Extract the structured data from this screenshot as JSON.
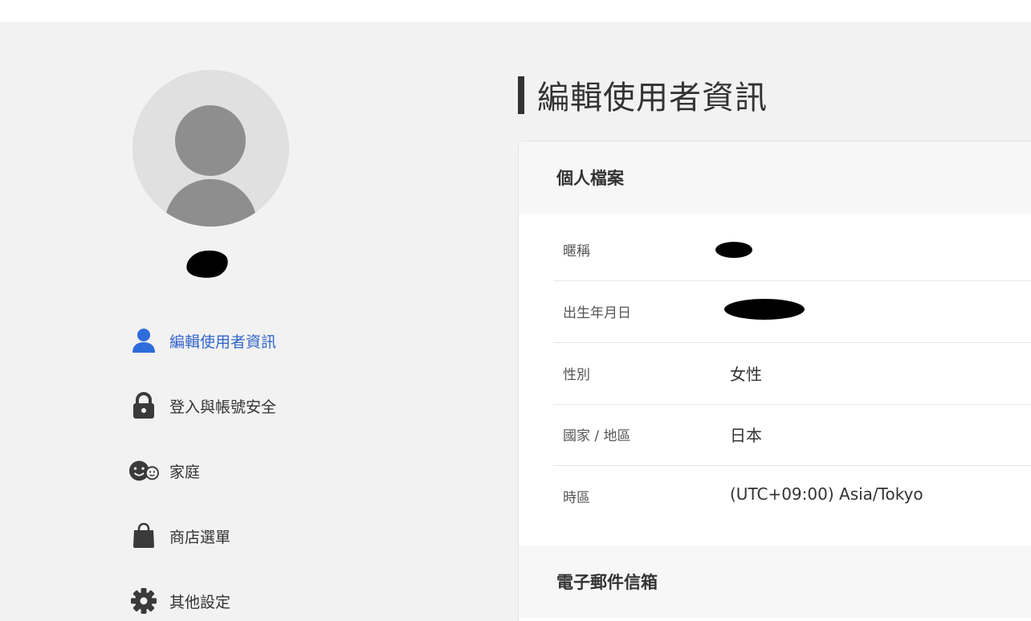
{
  "sidebar": {
    "items": [
      {
        "label": "編輯使用者資訊",
        "icon": "user-icon",
        "active": true
      },
      {
        "label": "登入與帳號安全",
        "icon": "lock-icon",
        "active": false
      },
      {
        "label": "家庭",
        "icon": "family-icon",
        "active": false
      },
      {
        "label": "商店選單",
        "icon": "shopping-bag-icon",
        "active": false
      },
      {
        "label": "其他設定",
        "icon": "gear-icon",
        "active": false
      }
    ]
  },
  "main": {
    "title": "編輯使用者資訊",
    "profile": {
      "heading": "個人檔案",
      "fields": [
        {
          "label": "暱稱",
          "value": ""
        },
        {
          "label": "出生年月日",
          "value": ""
        },
        {
          "label": "性別",
          "value": "女性"
        },
        {
          "label": "國家 / 地區",
          "value": "日本"
        },
        {
          "label": "時區",
          "value": "(UTC+09:00) Asia/Tokyo"
        }
      ]
    },
    "email": {
      "heading": "電子郵件信箱"
    }
  },
  "colors": {
    "accent": "#3366cc",
    "background": "#f2f2f2",
    "title_bar": "#333333"
  }
}
